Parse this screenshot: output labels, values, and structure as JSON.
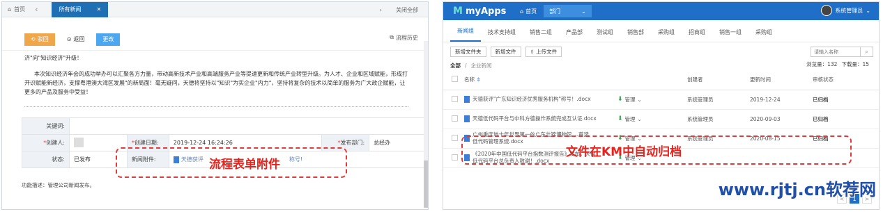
{
  "left": {
    "tabs": {
      "home_label": "首页",
      "active_label": "所有新闻",
      "close_all": "关闭全部"
    },
    "toolbar": {
      "return_label": "驳回",
      "back_label": "返回",
      "change_label": "更改",
      "flow_history": "流程历史"
    },
    "body": {
      "line1": "济\"向\"知识经济\"升级！",
      "para": "本次知识经济年会的成功举办可以汇聚各方力量，带动高新技术产业和高端服务产业等提速更新和传统产业转型升级。为人才、企业和区域赋能，形成打开识赋能新经济，支撑粤港澳大湾区发展\"的新局面！毫无疑问，天德将坚持以\"知识\"为实企业\"内力\"，坚持将复杂的技术以简单的服务为广大政企赋能，让更多的产品及服务中受益！"
    },
    "form": {
      "keywords_label": "关键词:",
      "creator_label": "创建人:",
      "created_date_label": "创建日期:",
      "created_date_value": "2019-12-24 16:24:26",
      "dept_label": "发布部门:",
      "dept_value": "总经办",
      "status_label": "状态:",
      "status_value": "已发布",
      "attachment_label": "新闻附件:",
      "attachment_value": "天德获评",
      "attachment_tail": "称号!"
    },
    "footer_note": "功能描述：管理公司新闻发布。",
    "callout": "流程表单附件"
  },
  "right": {
    "app_name": "myApps",
    "home_label": "首页",
    "dept_label": "部门",
    "user_label": "系统管理员",
    "group_tabs": [
      "新闻组",
      "技术支持组",
      "销售二组",
      "产品部",
      "测试组",
      "销售部",
      "采购组",
      "招商组",
      "销售一组",
      "采购组"
    ],
    "actions": {
      "new_folder": "新增文件夹",
      "new_file": "新增文件",
      "upload": "上传文件"
    },
    "search_placeholder": "请输入名称",
    "breadcrumb": {
      "root": "全部",
      "current": "企业新闻"
    },
    "counts": {
      "views": "浏览量：132",
      "downloads": "下载量：15"
    },
    "columns": {
      "name": "名称",
      "creator": "创建者",
      "updated": "更新时间",
      "audit": "审核状态"
    },
    "rows": [
      {
        "name": "天德获评\"广东知识经济优秀服务机构\"称号！.docx",
        "mgr": "管理",
        "creator": "系统管理员",
        "date": "2019-12-24",
        "status": "已归档"
      },
      {
        "name": "天德低代码平台与中科方德操作系统完成互认证.docx",
        "mgr": "管理",
        "creator": "系统管理员",
        "date": "2020-09-03",
        "status": "已归档"
      },
      {
        "name": "广州重庆地十年世界第一的广东壮锦博物馆....首选",
        "name2": "低代码管理系统.docx",
        "mgr": "管理",
        "creator": "系统管理员",
        "date": "2020-08-15",
        "status": "已归档"
      },
      {
        "name": "《2020年中国低代码平台指数测评报告》发布，天德",
        "name2": "低代码平台总负责人致谢！.docx",
        "mgr": "管理",
        "creator": "",
        "date": "",
        "status": ""
      }
    ],
    "pager": {
      "prev": "<",
      "page": "1",
      "next": ">"
    },
    "callout": "文件在KM中自动归档"
  },
  "watermark": "www.rjtj.cn软荐网"
}
